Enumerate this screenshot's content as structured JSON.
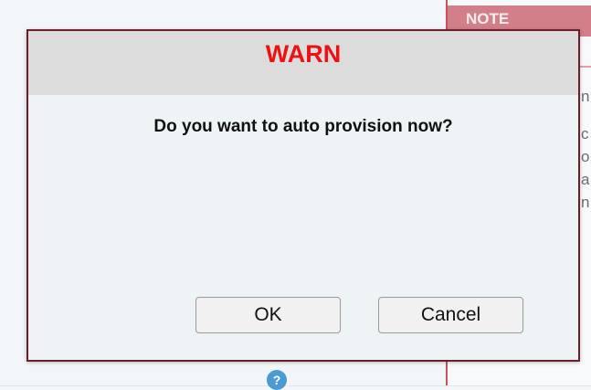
{
  "background": {
    "note_header": "NOTE",
    "note_snippets": [
      "n",
      "c",
      "o",
      "a",
      "n"
    ],
    "help_icon": "question-mark-icon"
  },
  "dialog": {
    "title": "WARN",
    "message": "Do you want to auto provision now?",
    "ok_label": "OK",
    "cancel_label": "Cancel"
  },
  "colors": {
    "title_red": "#ee1111",
    "dialog_border": "#6b1f28",
    "note_header_bg": "#d27f89",
    "help_icon_blue": "#4a9ad4"
  }
}
